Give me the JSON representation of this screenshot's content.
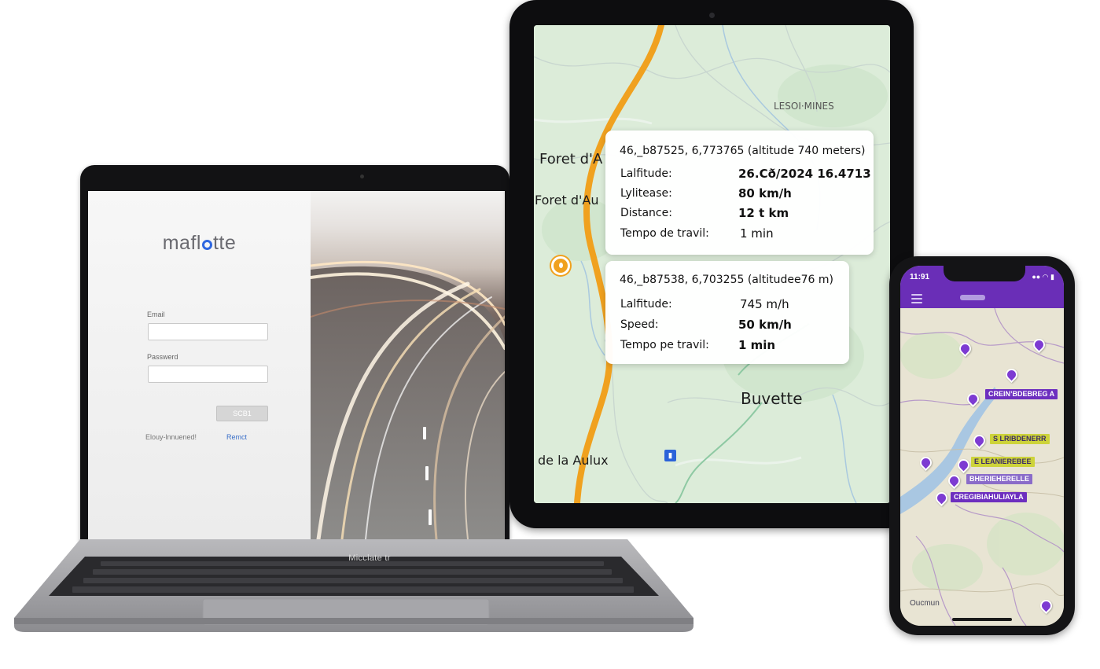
{
  "laptop": {
    "brand": {
      "before": "mafl",
      "after": "tte"
    },
    "email_label": "Email",
    "email_value": "",
    "password_label": "Passwerd",
    "password_value": "",
    "submit_label": "SCB1",
    "link_left": "Elouy-lnnuened!",
    "link_right": "Remct",
    "base_label": "Micclate tr"
  },
  "tablet": {
    "map": {
      "places": [
        "LESOI·MINES",
        "Foret d'A",
        "Foret d'Au",
        "Buvette",
        "de la Aulux"
      ],
      "route_color": "#f0a11f"
    },
    "card1": {
      "header": "46,_b87525, 6,773765 (altitude 740 meters)",
      "rows": [
        {
          "label": "Lalfitude:",
          "value": "26.Cð/2024 16.4713"
        },
        {
          "label": "Lylitease:",
          "value": "80 km/h"
        },
        {
          "label": "Distance:",
          "value": "12 t km"
        },
        {
          "label": "Tempo de travil:",
          "value": "1 min"
        }
      ]
    },
    "card2": {
      "header": "46,_b87538, 6,703255 (altitudee76 m)",
      "rows": [
        {
          "label": "Lalfitude:",
          "value": "745 m/h"
        },
        {
          "label": "Speed:",
          "value": "50 km/h"
        },
        {
          "label": "Tempo pe travil:",
          "value": "1 min"
        }
      ]
    }
  },
  "phone": {
    "status_time": "11:91",
    "status_icons": "●● ◠ ▮",
    "header_color": "#6a2eb7",
    "tags": [
      "CREIN’BDEBREG A",
      "S LRIBDENERR",
      "E LEANIEREBEE",
      "BHERIEHERELLE",
      "CREGIBIAHULIAYLA"
    ],
    "footer": "Oucmun"
  },
  "colors": {
    "accent_blue": "#2f67e0",
    "route_orange": "#f0a11f",
    "pin_purple": "#7d3bd2",
    "tag_yellow": "#cdd33a"
  }
}
